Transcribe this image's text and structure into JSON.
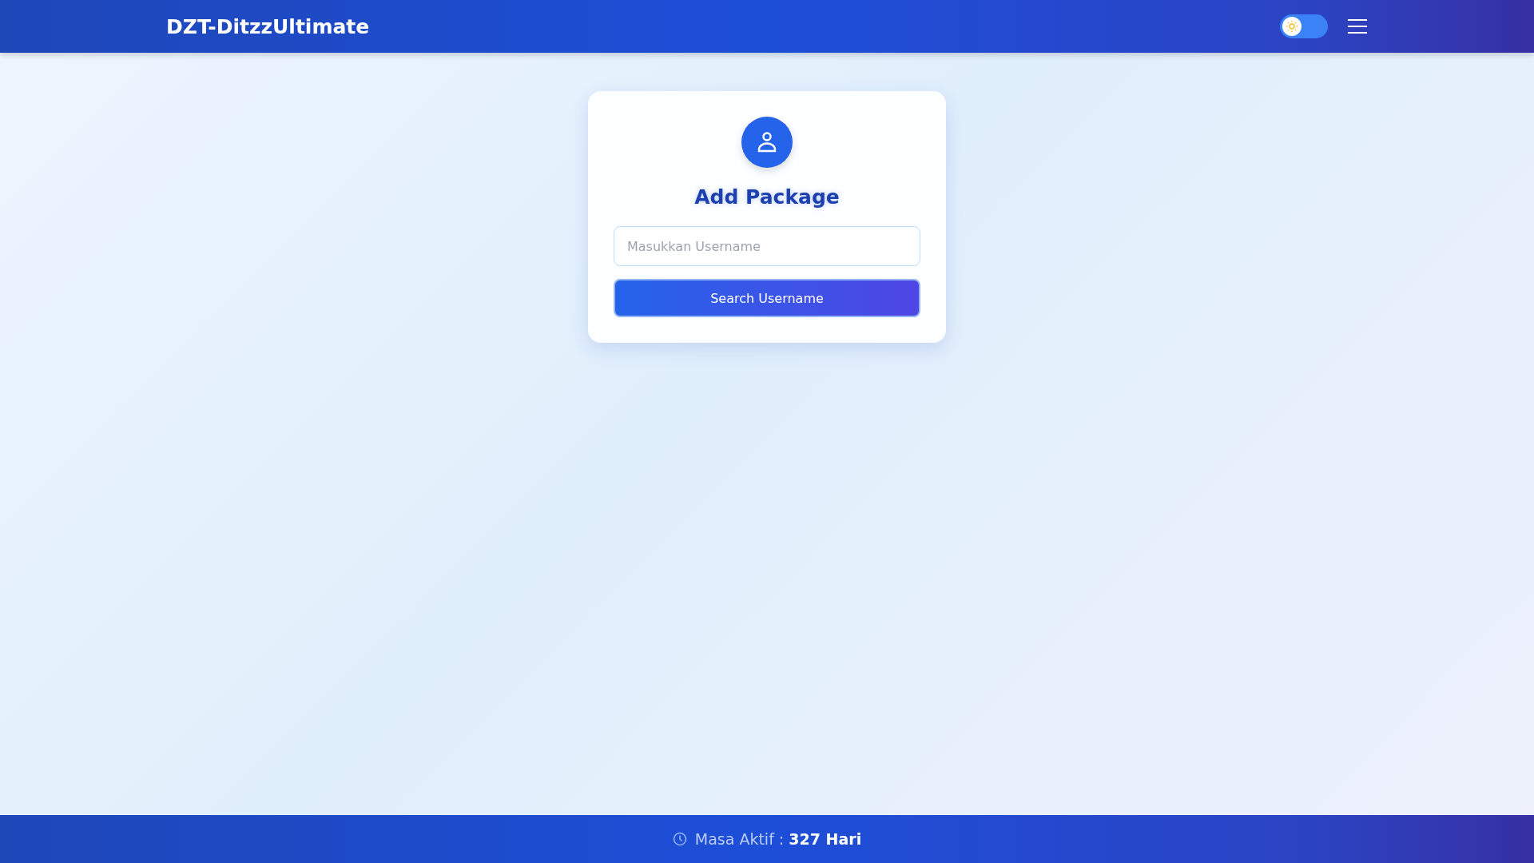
{
  "header": {
    "brand": "DZT-DitzzUltimate",
    "dark_mode": {
      "on": false
    }
  },
  "card": {
    "title": "Add Package",
    "username_field": {
      "placeholder": "Masukkan Username"
    },
    "button": "Search Username"
  },
  "footer": {
    "text": "Masa Aktif : **327 Hari**"
  }
}
